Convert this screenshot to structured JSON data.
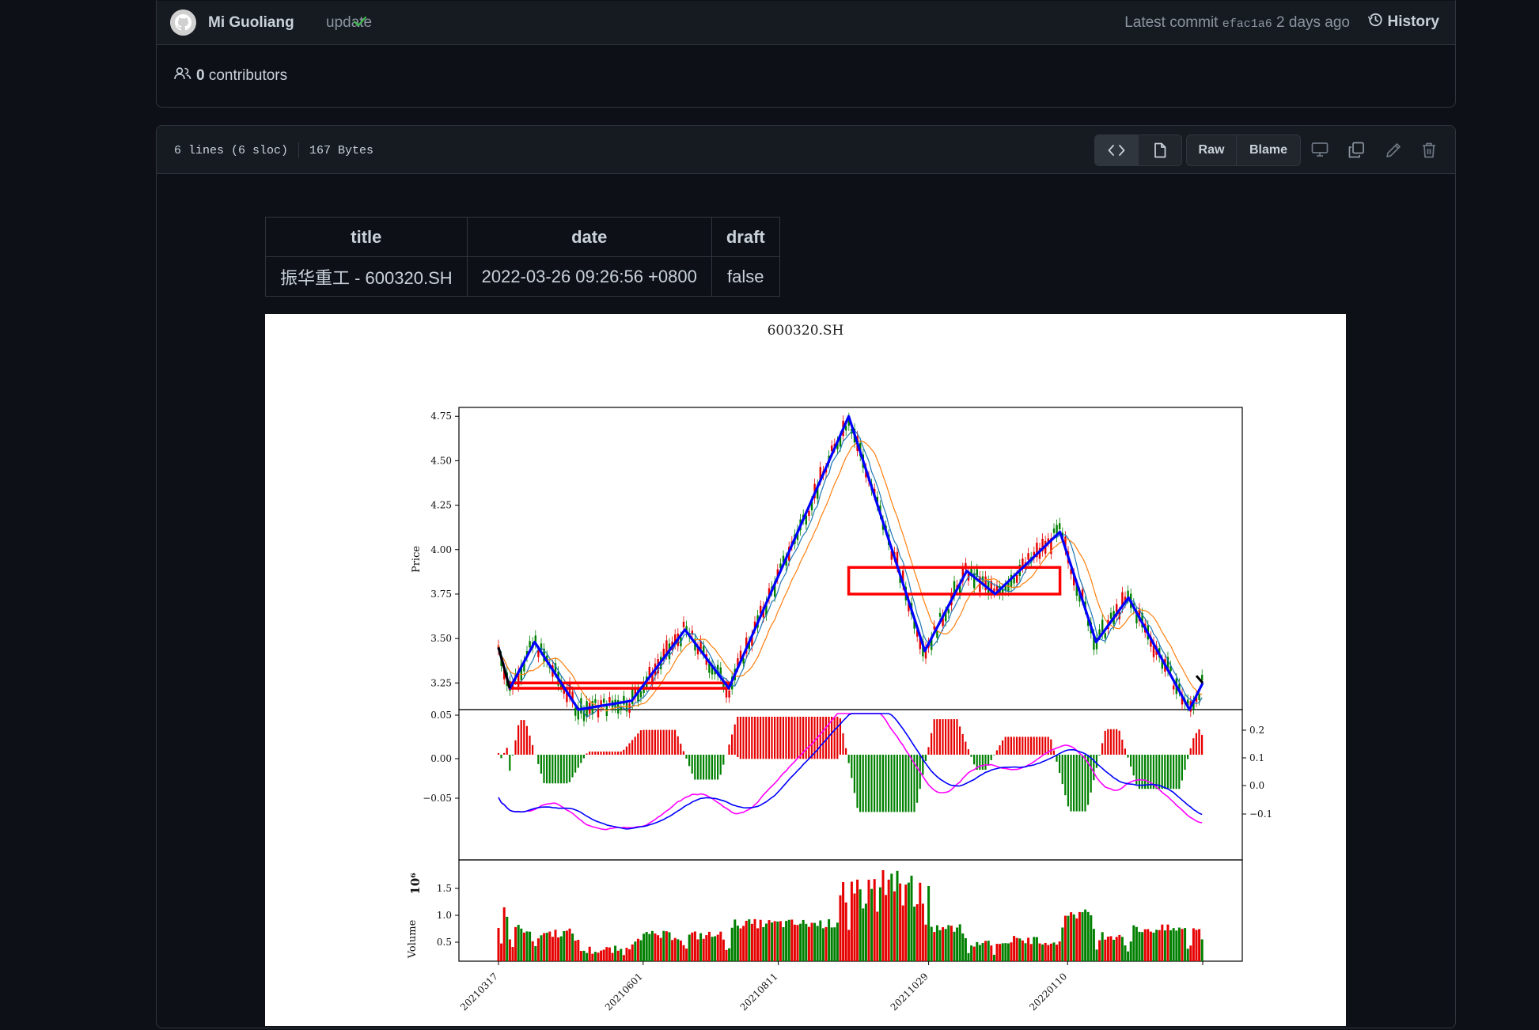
{
  "commit": {
    "author": "Mi Guoliang",
    "message": "update",
    "latest_label": "Latest commit",
    "sha": "efac1a6",
    "age": "2 days ago",
    "history_label": "History"
  },
  "contributors": {
    "count": "0",
    "label": "contributors"
  },
  "file": {
    "lines": "6 lines (6 sloc)",
    "size": "167 Bytes",
    "raw_label": "Raw",
    "blame_label": "Blame"
  },
  "frontmatter": {
    "headers": [
      "title",
      "date",
      "draft"
    ],
    "row": [
      "振华重工 - 600320.SH",
      "2022-03-26 09:26:56 +0800",
      "false"
    ]
  },
  "icons": {
    "avatar": "github-avatar-icon",
    "check": "check-icon",
    "history": "history-clock-icon",
    "people": "people-icon",
    "code": "code-icon",
    "file": "file-icon",
    "desktop": "desktop-icon",
    "copy": "copy-icon",
    "edit": "pencil-icon",
    "delete": "trash-icon"
  },
  "colors": {
    "bg": "#0d1117",
    "panel": "#161b22",
    "border": "#30363d",
    "success": "#3fb950",
    "muted": "#8b949e"
  },
  "chart_data": {
    "type": "line",
    "title": "600320.SH",
    "panels": [
      {
        "name": "price",
        "ylabel": "Price",
        "yticks": [
          "3.25",
          "3.50",
          "3.75",
          "4.00",
          "4.25",
          "4.50",
          "4.75"
        ],
        "ylim": [
          3.1,
          4.8
        ],
        "zigzag_color": "#0000ff",
        "zigzag": [
          {
            "x": "20210317",
            "y": 3.45
          },
          {
            "x": "20210323",
            "y": 3.22
          },
          {
            "x": "20210405",
            "y": 3.48
          },
          {
            "x": "20210428",
            "y": 3.1
          },
          {
            "x": "20210526",
            "y": 3.15
          },
          {
            "x": "20210623",
            "y": 3.55
          },
          {
            "x": "20210716",
            "y": 3.22
          },
          {
            "x": "20210917",
            "y": 4.75
          },
          {
            "x": "20211027",
            "y": 3.43
          },
          {
            "x": "20211118",
            "y": 3.88
          },
          {
            "x": "20211203",
            "y": 3.75
          },
          {
            "x": "20220106",
            "y": 4.1
          },
          {
            "x": "20220125",
            "y": 3.48
          },
          {
            "x": "20220211",
            "y": 3.73
          },
          {
            "x": "20220315",
            "y": 3.1
          },
          {
            "x": "20220322",
            "y": 3.25
          }
        ],
        "central_zones_color": "#ff0000",
        "central_zones": [
          {
            "x_start": "20210323",
            "x_end": "20210716",
            "y_low": 3.22,
            "y_high": 3.25
          },
          {
            "x_start": "20210917",
            "x_end": "20220106",
            "y_low": 3.75,
            "y_high": 3.9
          }
        ]
      },
      {
        "name": "macd",
        "yticks_left": [
          "0.05",
          "0.00",
          "−0.05"
        ],
        "yticks_right": [
          "0.2",
          "0.1",
          "0.0",
          "−0.1"
        ]
      },
      {
        "name": "volume",
        "ylabel": "Volume",
        "scale_label": "10⁶",
        "yticks": [
          "0.5",
          "1.0",
          "1.5"
        ]
      }
    ],
    "xticks": [
      "20210317",
      "20210601",
      "20210811",
      "20211029",
      "20220110"
    ]
  }
}
